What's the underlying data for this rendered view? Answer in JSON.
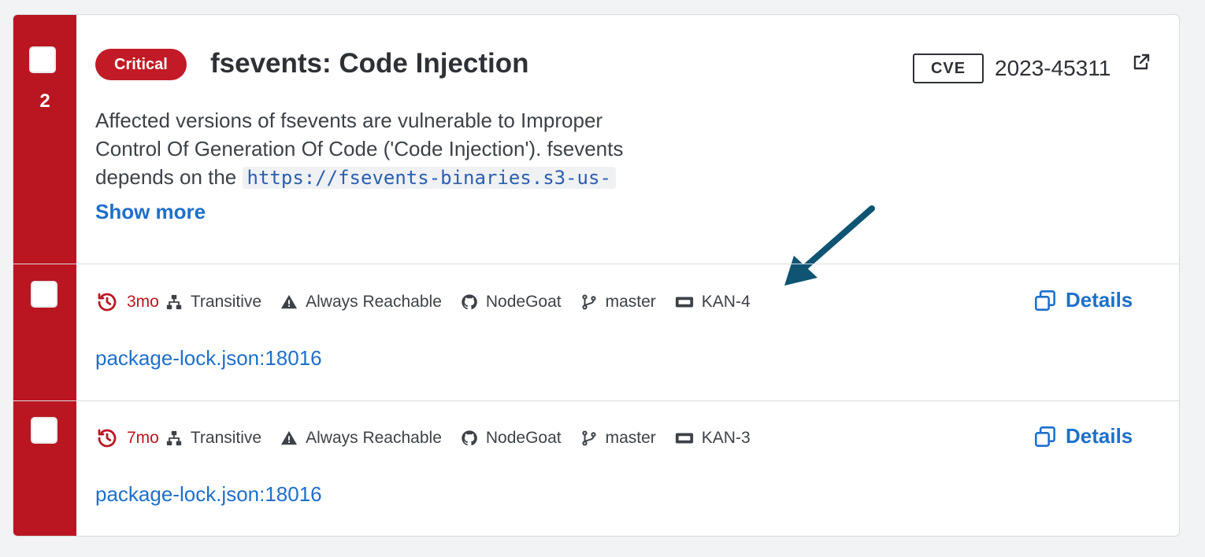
{
  "finding": {
    "count": "2",
    "severity": "Critical",
    "title": "fsevents: Code Injection",
    "cve_label": "CVE",
    "cve_id": "2023-45311",
    "description_line1": "Affected versions of fsevents are vulnerable to Improper",
    "description_line2": "Control Of Generation Of Code ('Code Injection'). fsevents",
    "description_line3": "depends on the",
    "description_code": "https://fsevents-binaries.s3-us-",
    "show_more": "Show more"
  },
  "occurrences": [
    {
      "age": "3mo",
      "dependency": "Transitive",
      "reachability": "Always Reachable",
      "repo": "NodeGoat",
      "branch": "master",
      "ticket": "KAN-4",
      "details_label": "Details",
      "file": "package-lock.json:18016"
    },
    {
      "age": "7mo",
      "dependency": "Transitive",
      "reachability": "Always Reachable",
      "repo": "NodeGoat",
      "branch": "master",
      "ticket": "KAN-3",
      "details_label": "Details",
      "file": "package-lock.json:18016"
    }
  ],
  "colors": {
    "critical": "#b91621",
    "link": "#1f6fc9",
    "annotation_arrow": "#0f5472"
  },
  "icons": [
    "history-icon",
    "hierarchy-icon",
    "warning-icon",
    "github-icon",
    "branch-icon",
    "ticket-icon",
    "external-link-icon",
    "details-windows-icon"
  ]
}
